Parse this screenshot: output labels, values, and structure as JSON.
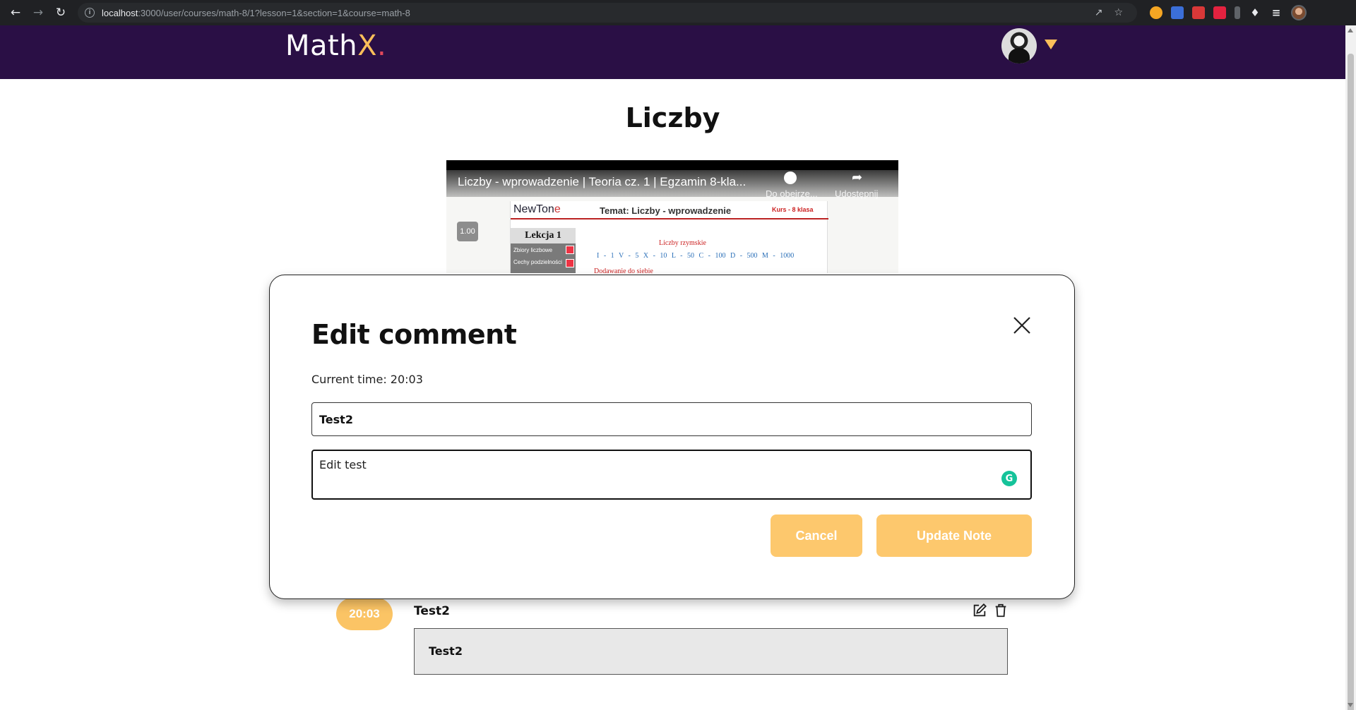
{
  "browser": {
    "url_host": "localhost",
    "url_path": ":3000/user/courses/math-8/1?lesson=1&section=1&course=math-8"
  },
  "header": {
    "logo_main": "Math",
    "logo_x": "X",
    "logo_dot": "."
  },
  "page": {
    "title": "Liczby"
  },
  "video": {
    "title": "Liczby - wprowadzenie | Teoria cz. 1 | Egzamin 8-kla...",
    "watch_later": "Do obejrze...",
    "share": "Udostępnij",
    "speed": "1.00",
    "brand": "NewTon",
    "brand_e": "e",
    "topic": "Temat: Liczby - wprowadzenie",
    "course_tag": "Kurs - 8 klasa",
    "lesson": "Lekcja 1",
    "lesson_item_1": "Zbiory liczbowe",
    "lesson_item_2": "Cechy podzielności",
    "roman_heading": "Liczby rzymskie",
    "roman_values": "I - 1   V - 5   X - 10   L - 50   C - 100   D - 500   M - 1000",
    "add_text": "Dodawanie do siebie"
  },
  "modal": {
    "title": "Edit comment",
    "current_time": "Current time: 20:03",
    "title_value": "Test2",
    "body_value": "Edit test",
    "cancel_label": "Cancel",
    "update_label": "Update Note"
  },
  "comment": {
    "time": "20:03",
    "title": "Test2",
    "body": "Test2"
  },
  "colors": {
    "header_bg": "#2a0f45",
    "accent": "#fbbf5a",
    "button_bg": "#fdc86d"
  }
}
